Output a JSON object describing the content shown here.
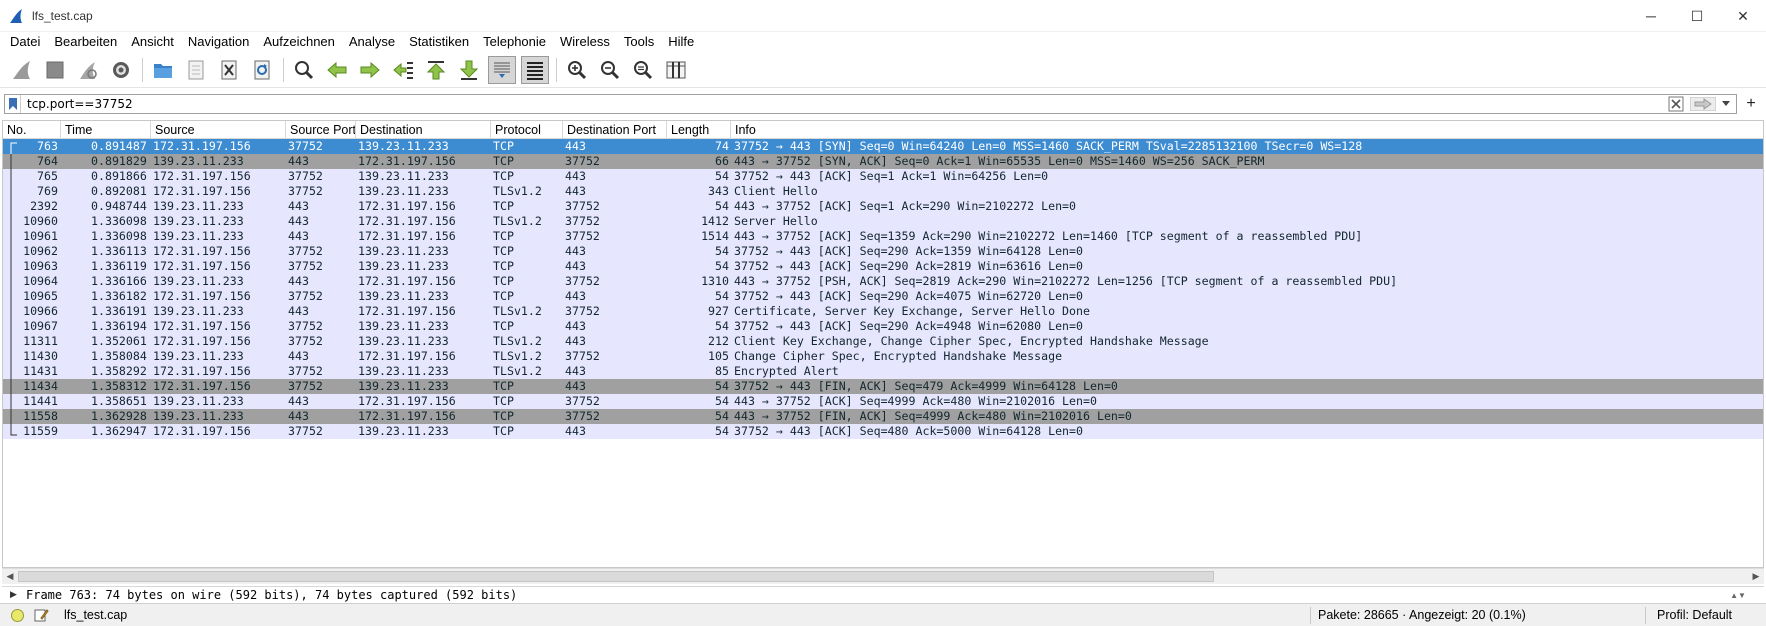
{
  "window": {
    "title": "lfs_test.cap",
    "controls": {
      "minimize": "─",
      "maximize": "☐",
      "close": "✕"
    }
  },
  "menu": [
    "Datei",
    "Bearbeiten",
    "Ansicht",
    "Navigation",
    "Aufzeichnen",
    "Analyse",
    "Statistiken",
    "Telephonie",
    "Wireless",
    "Tools",
    "Hilfe"
  ],
  "toolbar": {
    "icons": [
      "shark-fin-start-icon",
      "stop-capture-icon",
      "restart-capture-icon",
      "capture-options-icon",
      "open-folder-icon",
      "save-file-icon",
      "close-file-icon",
      "reload-icon",
      "find-packet-icon",
      "go-back-icon",
      "go-forward-icon",
      "go-to-packet-icon",
      "go-first-icon",
      "go-last-icon",
      "autoscroll-icon",
      "colorize-icon",
      "zoom-in-icon",
      "zoom-out-icon",
      "zoom-normal-icon",
      "resize-columns-icon"
    ]
  },
  "filter": {
    "value": "tcp.port==37752",
    "add_button": "+"
  },
  "packet_list": {
    "columns": [
      "No.",
      "Time",
      "Source",
      "Source Port",
      "Destination",
      "Protocol",
      "Destination Port",
      "Length",
      "Info"
    ],
    "rows": [
      {
        "no": "763",
        "time": "0.891487",
        "src": "172.31.197.156",
        "sport": "37752",
        "dst": "139.23.11.233",
        "proto": "TCP",
        "dport": "443",
        "len": "74",
        "info": "37752 → 443 [SYN] Seq=0 Win=64240 Len=0 MSS=1460 SACK_PERM TSval=2285132100 TSecr=0 WS=128",
        "style": "sel"
      },
      {
        "no": "764",
        "time": "0.891829",
        "src": "139.23.11.233",
        "sport": "443",
        "dst": "172.31.197.156",
        "proto": "TCP",
        "dport": "37752",
        "len": "66",
        "info": "443 → 37752 [SYN, ACK] Seq=0 Ack=1 Win=65535 Len=0 MSS=1460 WS=256 SACK_PERM",
        "style": "fin"
      },
      {
        "no": "765",
        "time": "0.891866",
        "src": "172.31.197.156",
        "sport": "37752",
        "dst": "139.23.11.233",
        "proto": "TCP",
        "dport": "443",
        "len": "54",
        "info": "37752 → 443 [ACK] Seq=1 Ack=1 Win=64256 Len=0",
        "style": "tcp"
      },
      {
        "no": "769",
        "time": "0.892081",
        "src": "172.31.197.156",
        "sport": "37752",
        "dst": "139.23.11.233",
        "proto": "TLSv1.2",
        "dport": "443",
        "len": "343",
        "info": "Client Hello",
        "style": "tcp"
      },
      {
        "no": "2392",
        "time": "0.948744",
        "src": "139.23.11.233",
        "sport": "443",
        "dst": "172.31.197.156",
        "proto": "TCP",
        "dport": "37752",
        "len": "54",
        "info": "443 → 37752 [ACK] Seq=1 Ack=290 Win=2102272 Len=0",
        "style": "tcp"
      },
      {
        "no": "10960",
        "time": "1.336098",
        "src": "139.23.11.233",
        "sport": "443",
        "dst": "172.31.197.156",
        "proto": "TLSv1.2",
        "dport": "37752",
        "len": "1412",
        "info": "Server Hello",
        "style": "tcp"
      },
      {
        "no": "10961",
        "time": "1.336098",
        "src": "139.23.11.233",
        "sport": "443",
        "dst": "172.31.197.156",
        "proto": "TCP",
        "dport": "37752",
        "len": "1514",
        "info": "443 → 37752 [ACK] Seq=1359 Ack=290 Win=2102272 Len=1460 [TCP segment of a reassembled PDU]",
        "style": "tcp"
      },
      {
        "no": "10962",
        "time": "1.336113",
        "src": "172.31.197.156",
        "sport": "37752",
        "dst": "139.23.11.233",
        "proto": "TCP",
        "dport": "443",
        "len": "54",
        "info": "37752 → 443 [ACK] Seq=290 Ack=1359 Win=64128 Len=0",
        "style": "tcp"
      },
      {
        "no": "10963",
        "time": "1.336119",
        "src": "172.31.197.156",
        "sport": "37752",
        "dst": "139.23.11.233",
        "proto": "TCP",
        "dport": "443",
        "len": "54",
        "info": "37752 → 443 [ACK] Seq=290 Ack=2819 Win=63616 Len=0",
        "style": "tcp"
      },
      {
        "no": "10964",
        "time": "1.336166",
        "src": "139.23.11.233",
        "sport": "443",
        "dst": "172.31.197.156",
        "proto": "TCP",
        "dport": "37752",
        "len": "1310",
        "info": "443 → 37752 [PSH, ACK] Seq=2819 Ack=290 Win=2102272 Len=1256 [TCP segment of a reassembled PDU]",
        "style": "tcp"
      },
      {
        "no": "10965",
        "time": "1.336182",
        "src": "172.31.197.156",
        "sport": "37752",
        "dst": "139.23.11.233",
        "proto": "TCP",
        "dport": "443",
        "len": "54",
        "info": "37752 → 443 [ACK] Seq=290 Ack=4075 Win=62720 Len=0",
        "style": "tcp"
      },
      {
        "no": "10966",
        "time": "1.336191",
        "src": "139.23.11.233",
        "sport": "443",
        "dst": "172.31.197.156",
        "proto": "TLSv1.2",
        "dport": "37752",
        "len": "927",
        "info": "Certificate, Server Key Exchange, Server Hello Done",
        "style": "tcp"
      },
      {
        "no": "10967",
        "time": "1.336194",
        "src": "172.31.197.156",
        "sport": "37752",
        "dst": "139.23.11.233",
        "proto": "TCP",
        "dport": "443",
        "len": "54",
        "info": "37752 → 443 [ACK] Seq=290 Ack=4948 Win=62080 Len=0",
        "style": "tcp"
      },
      {
        "no": "11311",
        "time": "1.352061",
        "src": "172.31.197.156",
        "sport": "37752",
        "dst": "139.23.11.233",
        "proto": "TLSv1.2",
        "dport": "443",
        "len": "212",
        "info": "Client Key Exchange, Change Cipher Spec, Encrypted Handshake Message",
        "style": "tcp"
      },
      {
        "no": "11430",
        "time": "1.358084",
        "src": "139.23.11.233",
        "sport": "443",
        "dst": "172.31.197.156",
        "proto": "TLSv1.2",
        "dport": "37752",
        "len": "105",
        "info": "Change Cipher Spec, Encrypted Handshake Message",
        "style": "tcp"
      },
      {
        "no": "11431",
        "time": "1.358292",
        "src": "172.31.197.156",
        "sport": "37752",
        "dst": "139.23.11.233",
        "proto": "TLSv1.2",
        "dport": "443",
        "len": "85",
        "info": "Encrypted Alert",
        "style": "tcp"
      },
      {
        "no": "11434",
        "time": "1.358312",
        "src": "172.31.197.156",
        "sport": "37752",
        "dst": "139.23.11.233",
        "proto": "TCP",
        "dport": "443",
        "len": "54",
        "info": "37752 → 443 [FIN, ACK] Seq=479 Ack=4999 Win=64128 Len=0",
        "style": "fin"
      },
      {
        "no": "11441",
        "time": "1.358651",
        "src": "139.23.11.233",
        "sport": "443",
        "dst": "172.31.197.156",
        "proto": "TCP",
        "dport": "37752",
        "len": "54",
        "info": "443 → 37752 [ACK] Seq=4999 Ack=480 Win=2102016 Len=0",
        "style": "tcp"
      },
      {
        "no": "11558",
        "time": "1.362928",
        "src": "139.23.11.233",
        "sport": "443",
        "dst": "172.31.197.156",
        "proto": "TCP",
        "dport": "37752",
        "len": "54",
        "info": "443 → 37752 [FIN, ACK] Seq=4999 Ack=480 Win=2102016 Len=0",
        "style": "fin"
      },
      {
        "no": "11559",
        "time": "1.362947",
        "src": "172.31.197.156",
        "sport": "37752",
        "dst": "139.23.11.233",
        "proto": "TCP",
        "dport": "443",
        "len": "54",
        "info": "37752 → 443 [ACK] Seq=480 Ack=5000 Win=64128 Len=0",
        "style": "tcp"
      }
    ]
  },
  "detail": {
    "line": "Frame 763: 74 bytes on wire (592 bits), 74 bytes captured (592 bits)"
  },
  "status": {
    "file": "lfs_test.cap",
    "packets": "Pakete: 28665 · Angezeigt: 20 (0.1%)",
    "profile": "Profil: Default"
  },
  "colors": {
    "selected_row": "#3d8cd1",
    "tcp_row": "#e7e6ff",
    "fin_row": "#a0a0a0",
    "text": "#12272e"
  }
}
